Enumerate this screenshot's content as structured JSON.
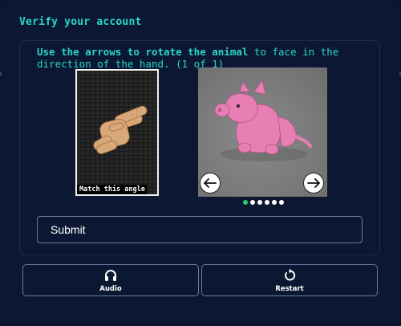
{
  "header": {
    "title": "Verify your account"
  },
  "challenge": {
    "instruction_prefix": "Use the arrows to rotate the animal",
    "instruction_suffix": " to face in the direction of the hand.",
    "counter": " (1 of 1)",
    "reference_caption": "Match this angle",
    "carousel": {
      "total": 6,
      "active_index": 0
    }
  },
  "actions": {
    "submit_label": "Submit",
    "audio_label": "Audio",
    "restart_label": "Restart"
  }
}
